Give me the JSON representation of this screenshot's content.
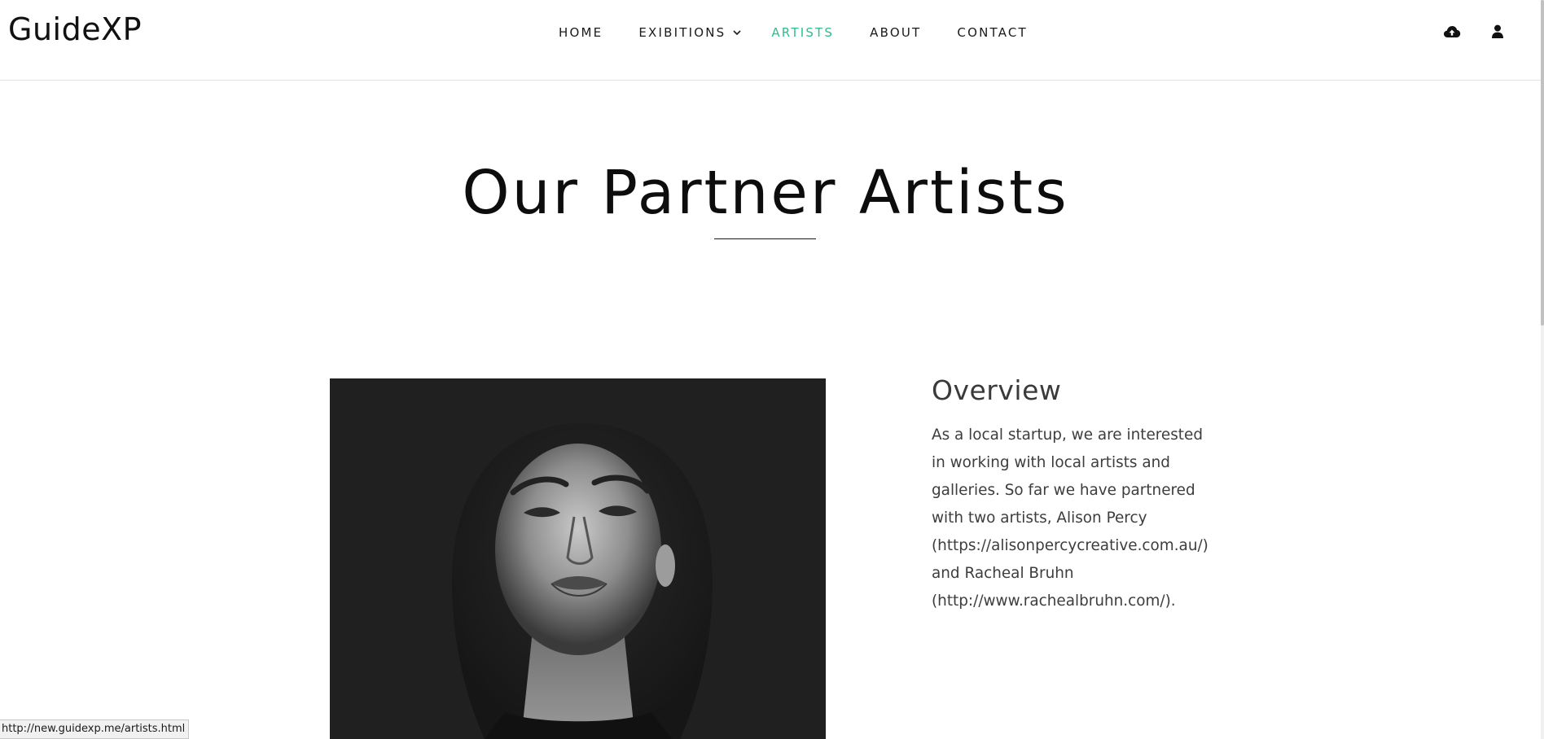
{
  "header": {
    "logo": "GuideXP",
    "nav": [
      {
        "label": "HOME"
      },
      {
        "label": "EXIBITIONS"
      },
      {
        "label": "ARTISTS"
      },
      {
        "label": "ABOUT"
      },
      {
        "label": "CONTACT"
      }
    ],
    "active_color": "#2bbf8a",
    "icons": [
      "cloud-upload-icon",
      "user-icon"
    ]
  },
  "main": {
    "title": "Our Partner Artists",
    "overview": {
      "heading": "Overview",
      "lines": [
        "As a local startup, we are interested",
        "in working with local artists and",
        "galleries. So far we have partnered",
        "with two artists, Alison Percy",
        "(https://alisonpercycreative.com.au/)",
        "and Racheal Bruhn",
        "(http://www.rachealbruhn.com/)."
      ]
    }
  },
  "status_bar": {
    "url": "http://new.guidexp.me/artists.html"
  }
}
